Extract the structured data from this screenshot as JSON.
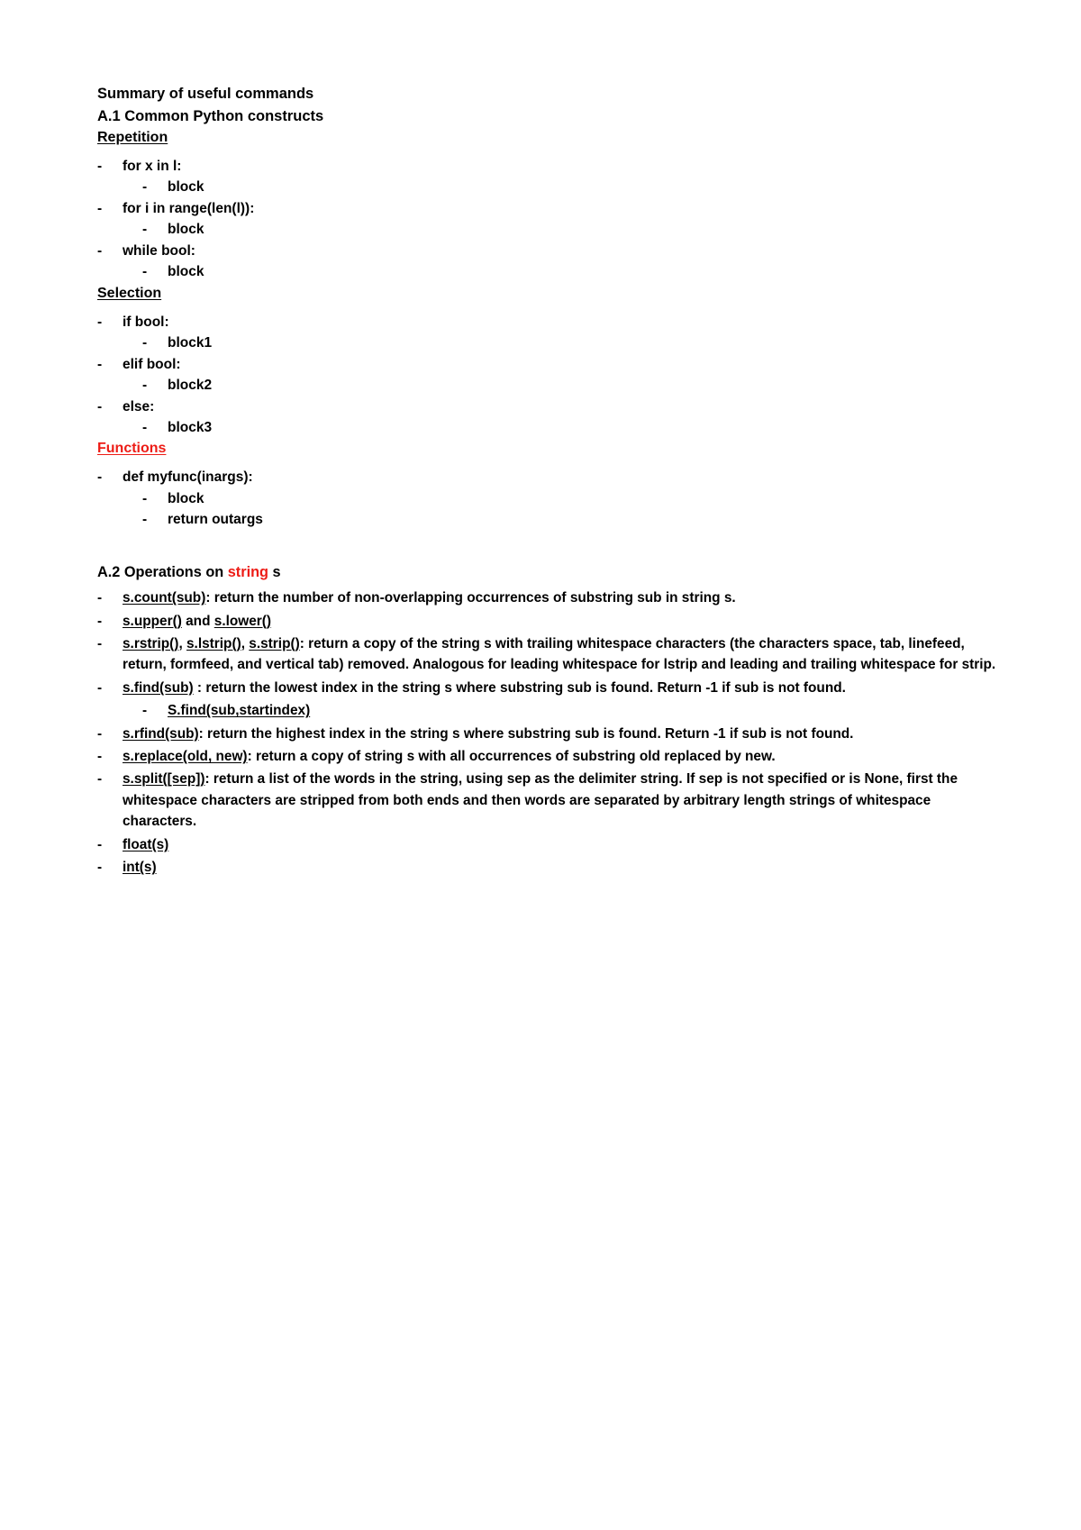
{
  "document": {
    "title": "Summary of useful commands",
    "section_a1": {
      "heading": "A.1 Common Python constructs",
      "groups": [
        {
          "name": "Repetition",
          "items": [
            {
              "text": "for x in l:",
              "children": [
                "block"
              ]
            },
            {
              "text": "for i in range(len(l)):",
              "children": [
                "block"
              ]
            },
            {
              "text": "while bool:",
              "children": [
                "block"
              ]
            }
          ]
        },
        {
          "name": "Selection",
          "items": [
            {
              "text": "if bool:",
              "children": [
                "block1"
              ]
            },
            {
              "text": "elif bool:",
              "children": [
                "block2"
              ]
            },
            {
              "text": "else:",
              "children": [
                "block3"
              ]
            }
          ]
        },
        {
          "name": "Functions",
          "color": "#ED1C16",
          "items": [
            {
              "text": "def myfunc(inargs):",
              "children": [
                "block",
                "return outargs"
              ]
            }
          ]
        }
      ]
    },
    "section_a2": {
      "heading_prefix": "A.2 Operations on ",
      "heading_keyword": "string",
      "heading_suffix": " s",
      "items": [
        {
          "term": "s.count(sub)",
          "body": ": return the number of non-overlapping occurrences of substring sub in string s."
        },
        {
          "term": "s.upper()",
          "mid": " and ",
          "term2": "s.lower()",
          "body": ""
        },
        {
          "term": "s.rstrip()",
          "term2": "s.lstrip()",
          "term3": "s.strip()",
          "body": ": return a copy of the string s with trailing whitespace characters (the characters space, tab, linefeed, return, formfeed, and vertical tab) removed. Analogous for leading whitespace for lstrip and leading and trailing whitespace for strip."
        },
        {
          "term": "s.find(sub)",
          "body": " : return the lowest index in the string s where substring sub is found. Return -1 if sub is not found.",
          "sub_items": [
            "S.find(sub,startindex)"
          ]
        },
        {
          "term": "s.rfind(sub)",
          "body": ": return the highest index in the string s where substring sub is found. Return -1 if sub is not found."
        },
        {
          "term": "s.replace(old, new)",
          "body": ": return a copy of string s with all occurrences of substring old replaced by new."
        },
        {
          "term": "s.split([sep])",
          "body": ": return a list of the words in the string, using sep as the delimiter string. If sep is not specified or is None, first the whitespace characters are stripped from both ends and then words are separated by arbitrary length strings of whitespace characters."
        },
        {
          "term": "float(s)",
          "body": ""
        },
        {
          "term": "int(s)",
          "body": ""
        }
      ]
    },
    "bullet_dash": "-"
  }
}
